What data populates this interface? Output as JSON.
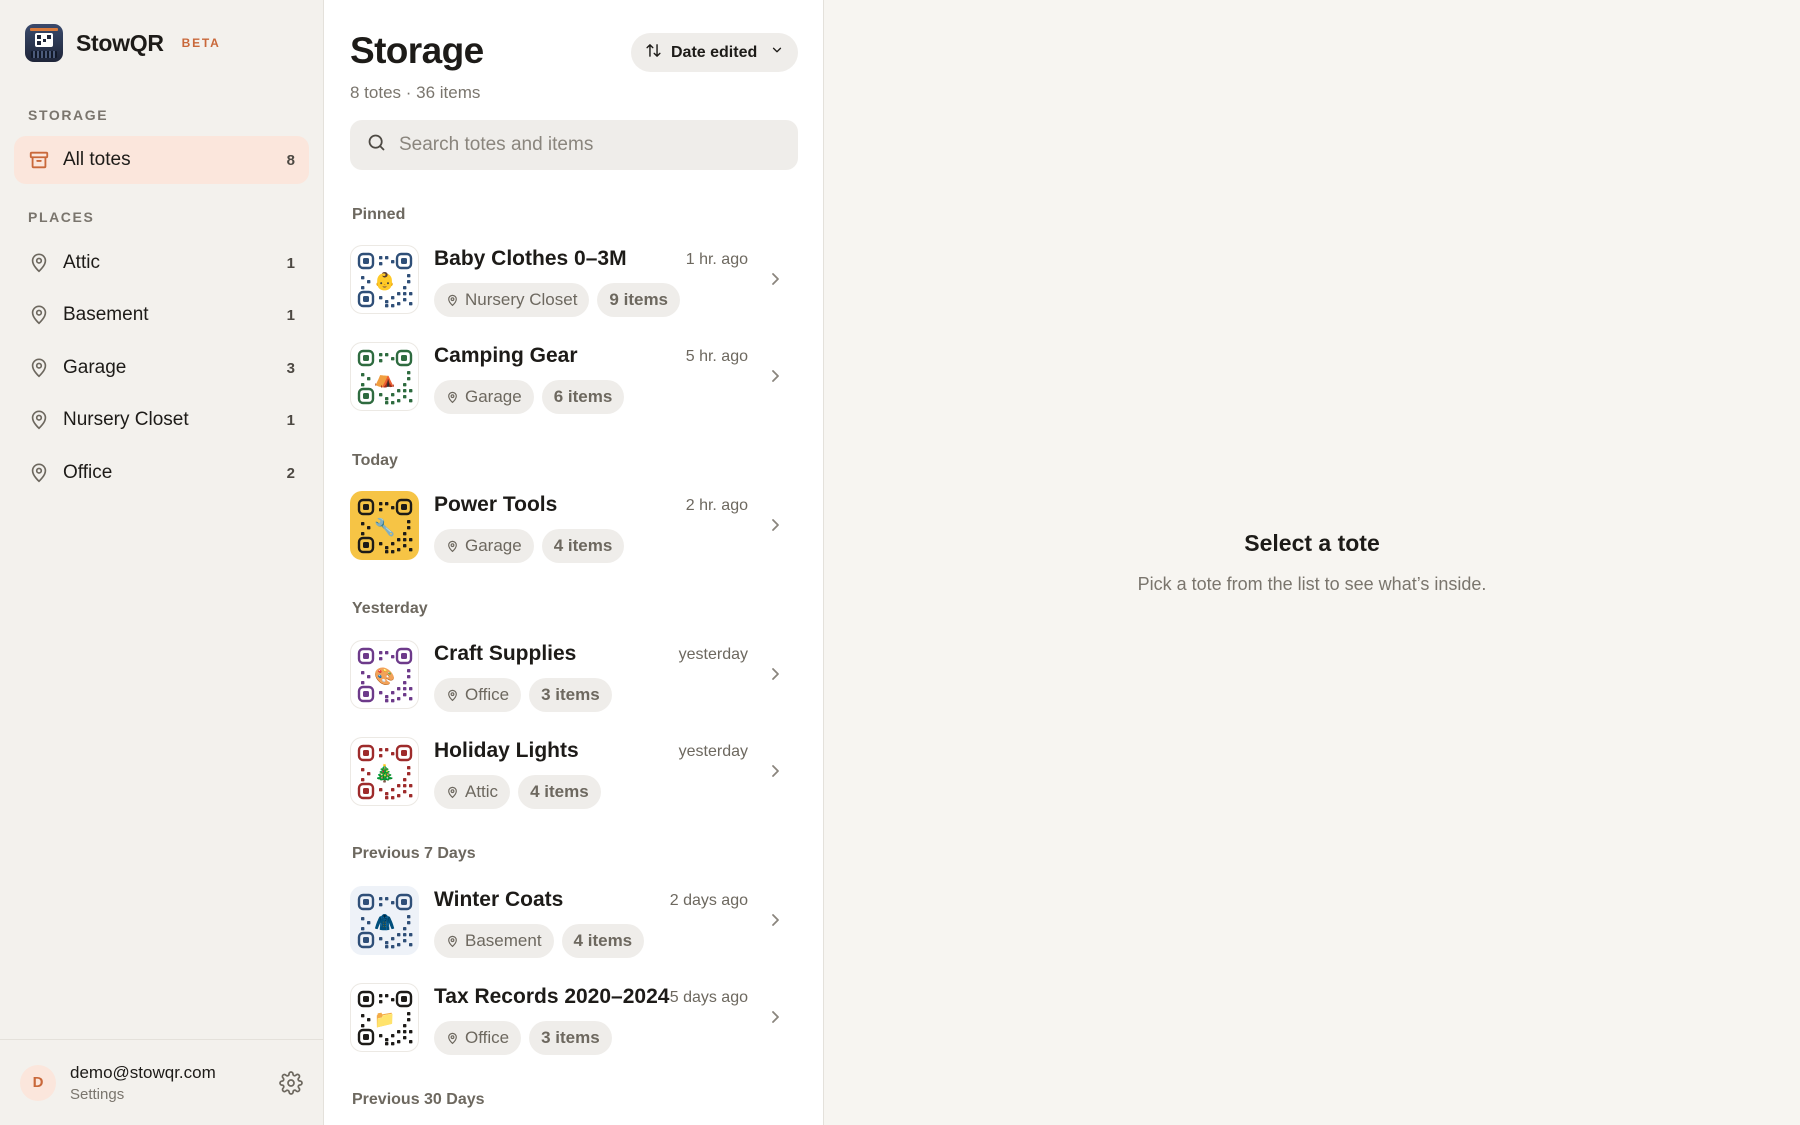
{
  "app": {
    "name": "StowQR",
    "badge": "BETA"
  },
  "sidebar": {
    "storage_label": "STORAGE",
    "all_totes": {
      "label": "All totes",
      "count": "8"
    },
    "places_label": "PLACES",
    "places": [
      {
        "label": "Attic",
        "count": "1"
      },
      {
        "label": "Basement",
        "count": "1"
      },
      {
        "label": "Garage",
        "count": "3"
      },
      {
        "label": "Nursery Closet",
        "count": "1"
      },
      {
        "label": "Office",
        "count": "2"
      }
    ],
    "user": {
      "initial": "D",
      "email": "demo@stowqr.com",
      "settings_label": "Settings"
    }
  },
  "list": {
    "title": "Storage",
    "subtitle": "8 totes · 36 items",
    "sort_label": "Date edited",
    "search_placeholder": "Search totes and items",
    "groups": [
      {
        "label": "Pinned"
      },
      {
        "label": "Today"
      },
      {
        "label": "Yesterday"
      },
      {
        "label": "Previous 7 Days"
      },
      {
        "label": "Previous 30 Days"
      }
    ],
    "totes": [
      {
        "name": "Baby Clothes 0–3M",
        "when": "1 hr. ago",
        "place": "Nursery Closet",
        "items": "9 items",
        "emoji": "👶",
        "color": "#2f4f78",
        "bg": "#ffffff"
      },
      {
        "name": "Camping Gear",
        "when": "5 hr. ago",
        "place": "Garage",
        "items": "6 items",
        "emoji": "⛺",
        "color": "#2e6b3f",
        "bg": "#ffffff"
      },
      {
        "name": "Power Tools",
        "when": "2 hr. ago",
        "place": "Garage",
        "items": "4 items",
        "emoji": "🔧",
        "color": "#1d1b18",
        "bg": "#f6c445"
      },
      {
        "name": "Craft Supplies",
        "when": "yesterday",
        "place": "Office",
        "items": "3 items",
        "emoji": "🎨",
        "color": "#6d3a8a",
        "bg": "#ffffff"
      },
      {
        "name": "Holiday Lights",
        "when": "yesterday",
        "place": "Attic",
        "items": "4 items",
        "emoji": "🎄",
        "color": "#9e2b2b",
        "bg": "#ffffff"
      },
      {
        "name": "Winter Coats",
        "when": "2 days ago",
        "place": "Basement",
        "items": "4 items",
        "emoji": "🧥",
        "color": "#2f4f78",
        "bg": "#eef2f8"
      },
      {
        "name": "Tax Records 2020–2024",
        "when": "5 days ago",
        "place": "Office",
        "items": "3 items",
        "emoji": "📁",
        "color": "#1d1b18",
        "bg": "#ffffff"
      }
    ]
  },
  "detail": {
    "empty_title": "Select a tote",
    "empty_subtitle": "Pick a tote from the list to see what’s inside."
  }
}
